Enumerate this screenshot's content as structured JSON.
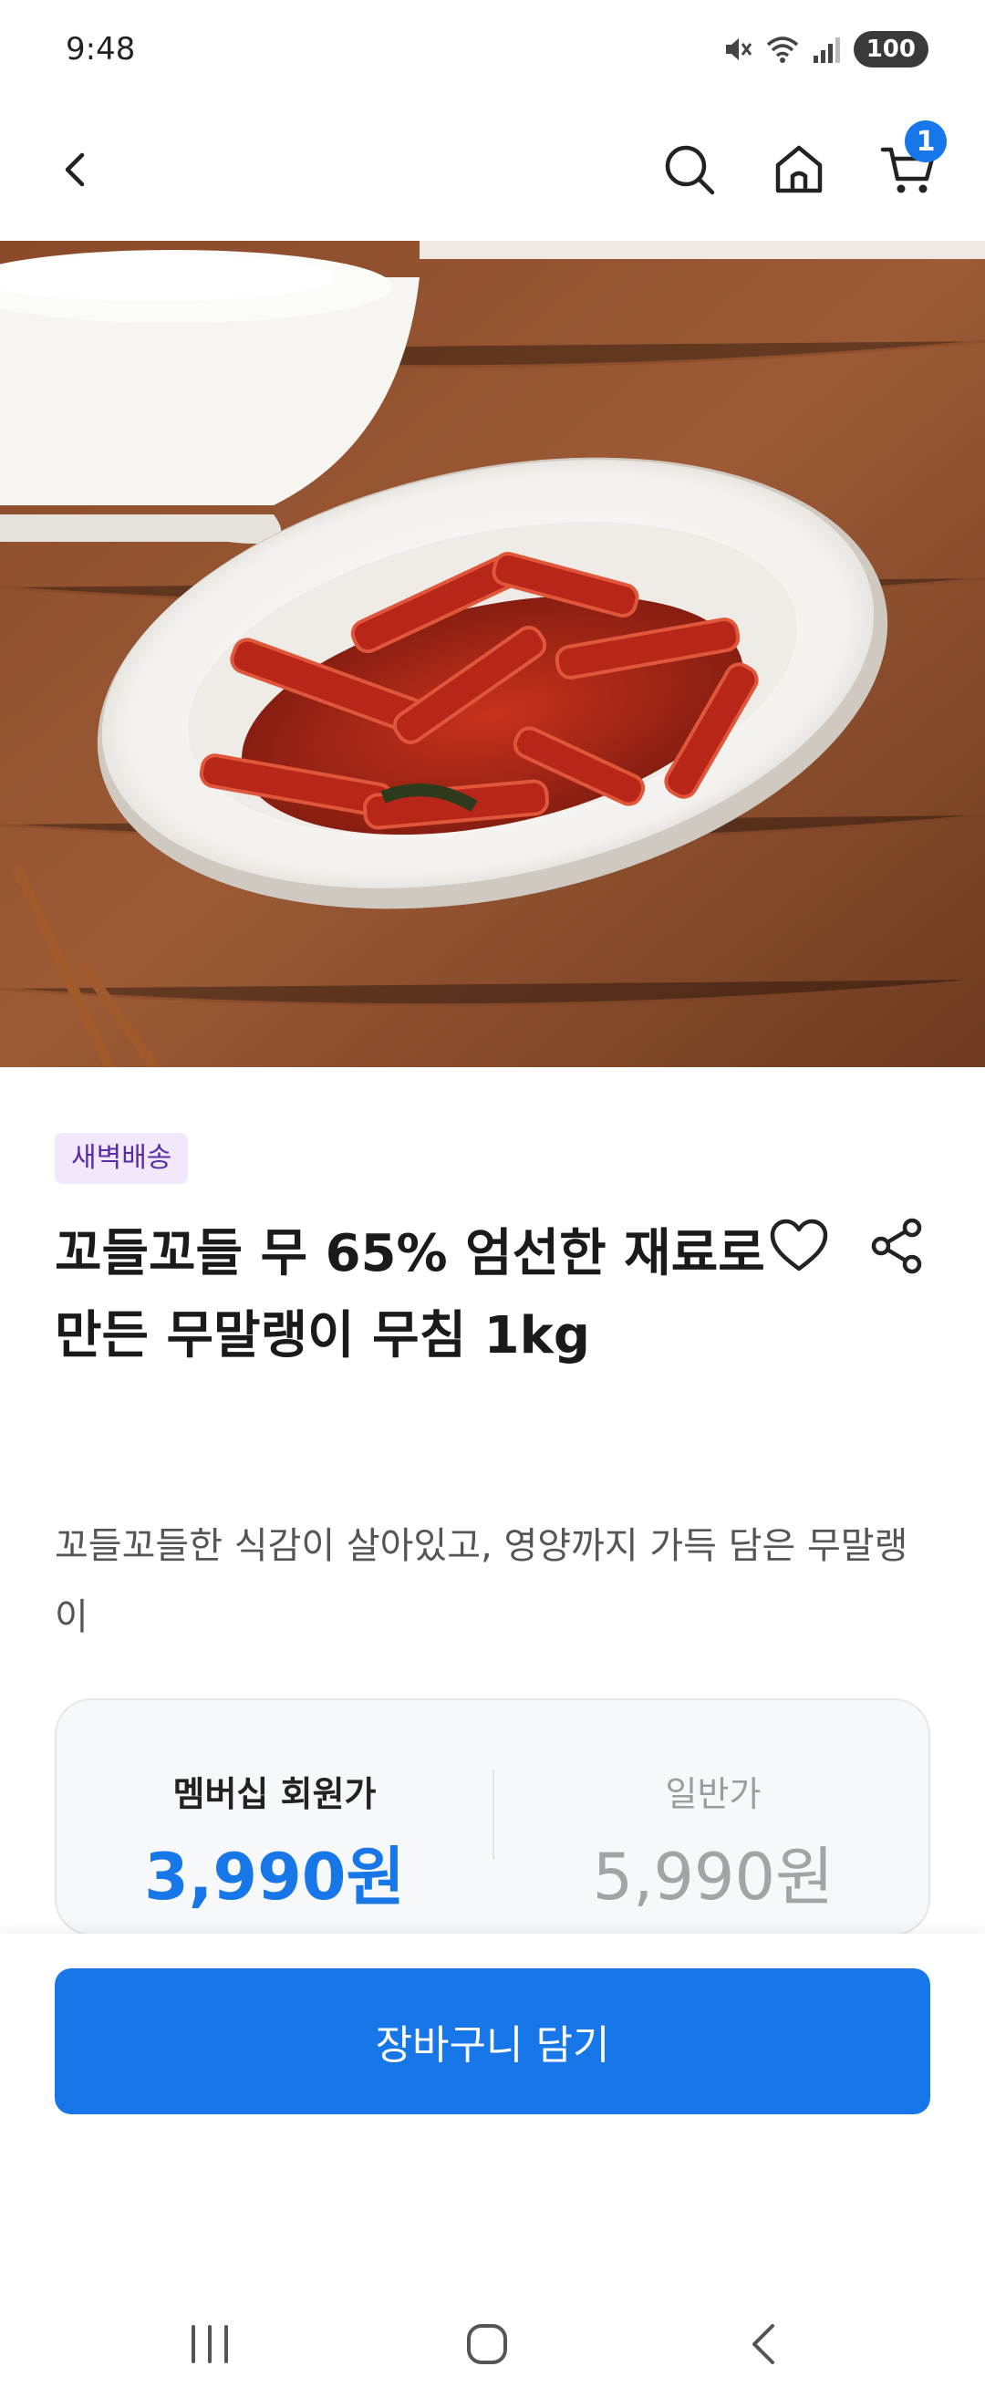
{
  "status_bar": {
    "time": "9:48",
    "battery": "100"
  },
  "nav": {
    "back_icon": "chevron-left-icon",
    "search_icon": "search-icon",
    "home_icon": "home-icon",
    "cart_icon": "cart-icon",
    "cart_count": "1"
  },
  "product": {
    "badge": "새벽배송",
    "title": "꼬들꼬들 무 65% 엄선한 재료로 만든 무말랭이 무침 1kg",
    "subtitle": "꼬들꼬들한 식감이 살아있고, 영양까지 가득 담은 무말랭이",
    "image": "radish-kimchi-photo"
  },
  "price": {
    "member_label": "멤버십 회원가",
    "member_price": "3,990원",
    "normal_label": "일반가",
    "normal_price": "5,990원"
  },
  "cta": {
    "add_to_cart": "장바구니 담기"
  },
  "colors": {
    "accent": "#1877e8",
    "badge_bg": "#f1e9fb",
    "badge_text": "#5b2ca8"
  }
}
